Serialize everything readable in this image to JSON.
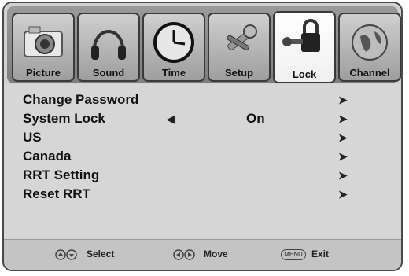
{
  "tabs": [
    {
      "label": "Picture",
      "icon": "camera-icon"
    },
    {
      "label": "Sound",
      "icon": "headphones-icon"
    },
    {
      "label": "Time",
      "icon": "clock-icon"
    },
    {
      "label": "Setup",
      "icon": "tools-icon"
    },
    {
      "label": "Lock",
      "icon": "lock-icon",
      "active": true
    },
    {
      "label": "Channel",
      "icon": "globe-icon"
    }
  ],
  "menu": {
    "items": [
      {
        "label": "Change Password"
      },
      {
        "label": "System Lock",
        "value": "On"
      },
      {
        "label": "US"
      },
      {
        "label": "Canada"
      },
      {
        "label": "RRT Setting"
      },
      {
        "label": "Reset RRT"
      }
    ],
    "arrow_right": "➤",
    "arrow_left": "◀"
  },
  "footer": {
    "select_label": "Select",
    "move_label": "Move",
    "menu_key": "MENU",
    "exit_label": "Exit"
  }
}
